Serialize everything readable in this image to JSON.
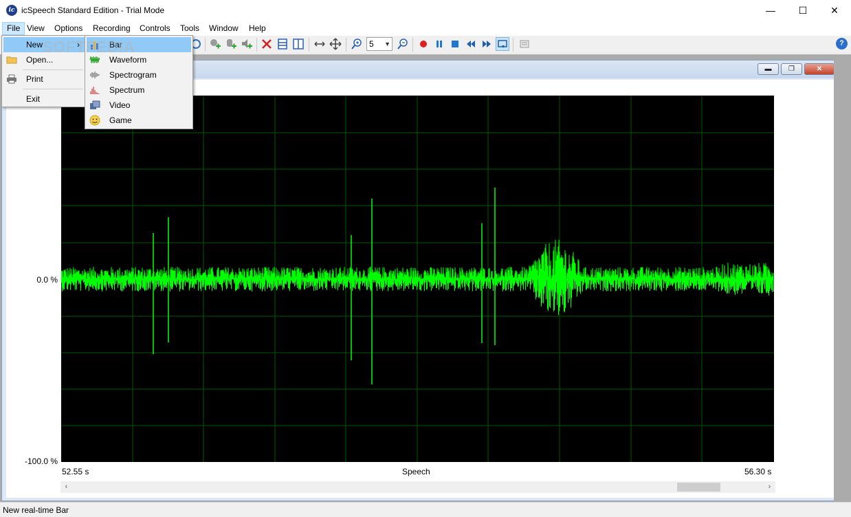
{
  "window": {
    "title": "icSpeech Standard Edition - Trial Mode",
    "app_icon_text": "ic",
    "minimize": "—",
    "maximize": "☐",
    "close": "✕"
  },
  "menubar": [
    "File",
    "View",
    "Options",
    "Recording",
    "Controls",
    "Tools",
    "Window",
    "Help"
  ],
  "toolbar": {
    "zoom_value": "5",
    "help_symbol": "?"
  },
  "file_menu": {
    "items": [
      "New",
      "Open...",
      "Print",
      "Exit"
    ],
    "submenu_arrow": "›"
  },
  "new_submenu": {
    "items": [
      "Bar",
      "Waveform",
      "Spectrogram",
      "Spectrum",
      "Video",
      "Game"
    ],
    "highlighted": "Bar"
  },
  "watermark": "SOFTPEDIA",
  "child_window": {
    "minimize": "▬",
    "restore": "❐",
    "close": "✕"
  },
  "plot": {
    "y_top": "",
    "y_mid": "0.0 %",
    "y_bottom": "-100.0 %",
    "x_start": "52.55 s",
    "x_label": "Speech",
    "x_end": "56.30 s"
  },
  "scrollbar": {
    "left_arrow": "‹",
    "right_arrow": "›"
  },
  "status": {
    "text": "New real-time Bar"
  },
  "colors": {
    "waveform": "#00ff00",
    "grid": "#005a00",
    "plot_bg": "#000000",
    "menu_highlight": "#91c9f7"
  }
}
